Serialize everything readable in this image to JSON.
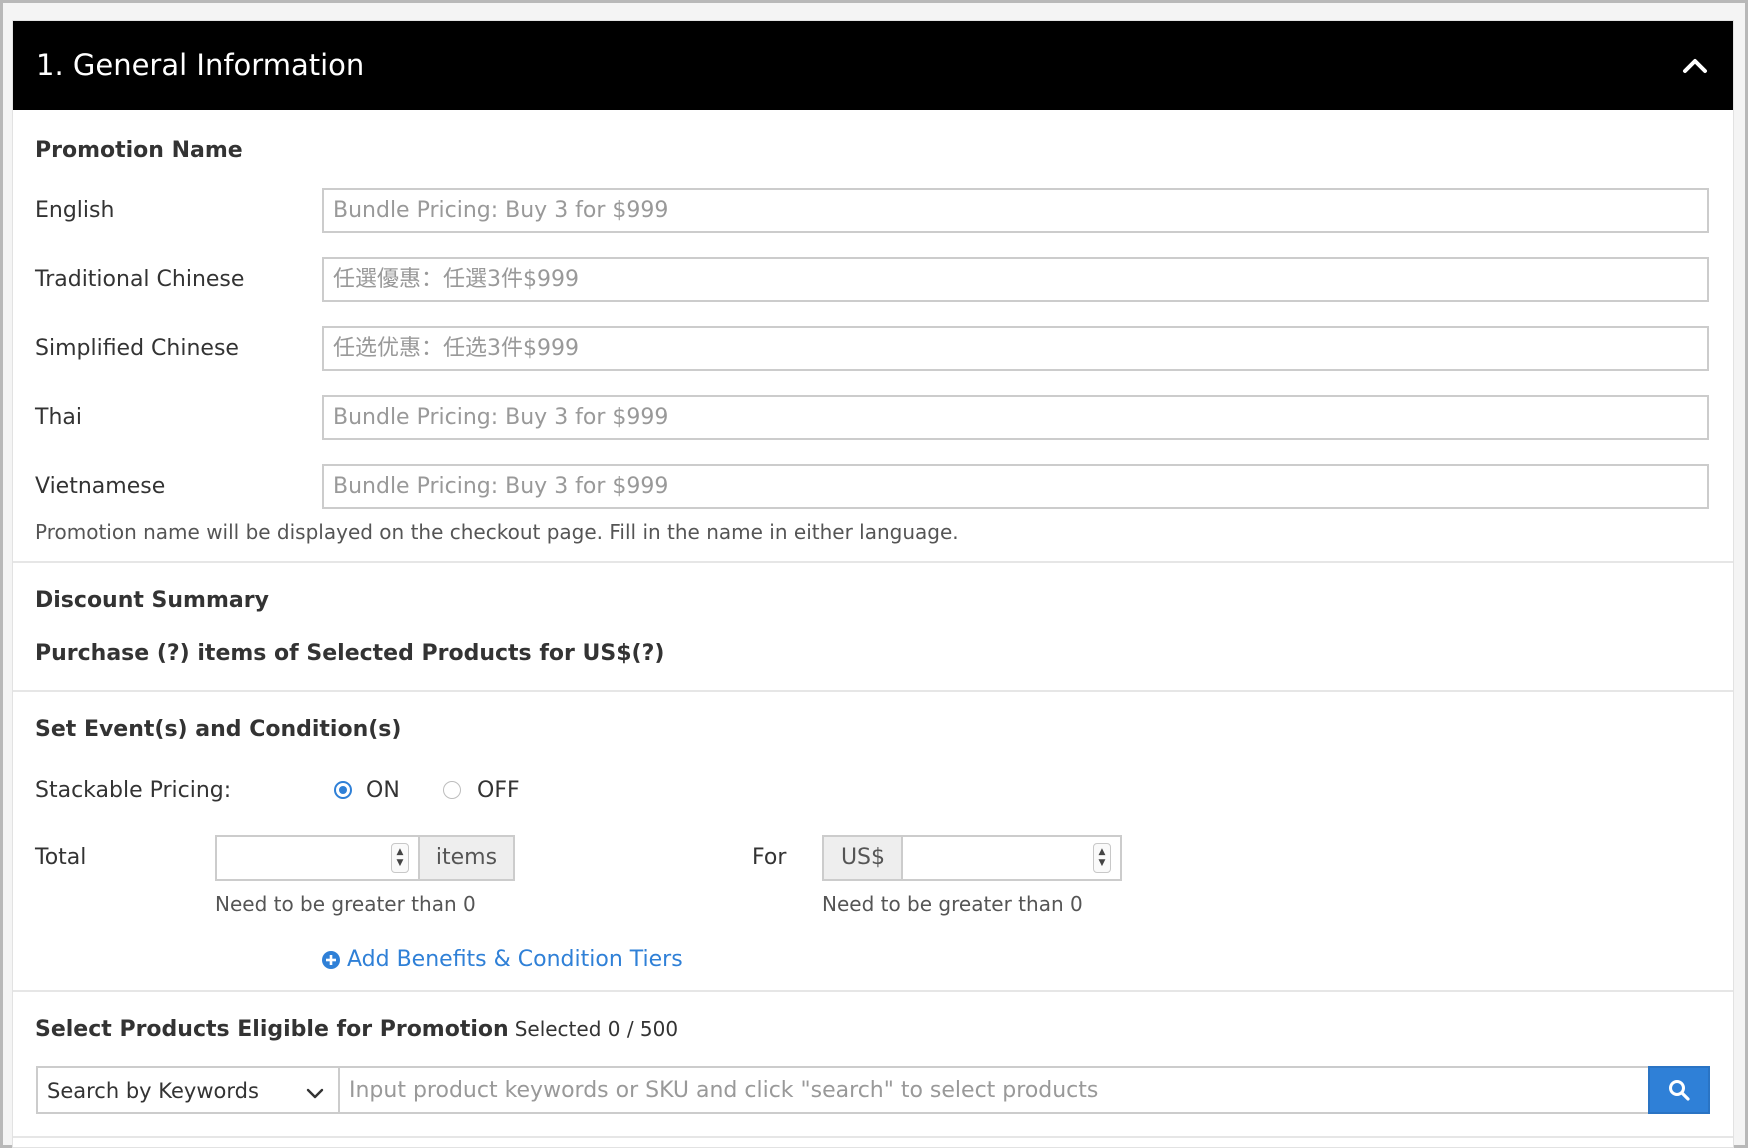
{
  "section": {
    "title": "1. General Information"
  },
  "promotion_name": {
    "title": "Promotion Name",
    "fields": [
      {
        "label": "English",
        "placeholder": "Bundle Pricing: Buy 3 for $999",
        "value": ""
      },
      {
        "label": "Traditional Chinese",
        "placeholder": "任選優惠：任選3件$999",
        "value": ""
      },
      {
        "label": "Simplified Chinese",
        "placeholder": "任选优惠：任选3件$999",
        "value": ""
      },
      {
        "label": "Thai",
        "placeholder": "Bundle Pricing: Buy 3 for $999",
        "value": ""
      },
      {
        "label": "Vietnamese",
        "placeholder": "Bundle Pricing: Buy 3 for $999",
        "value": ""
      }
    ],
    "help": "Promotion name will be displayed on the checkout page. Fill in the name in either language."
  },
  "discount_summary": {
    "title": "Discount Summary",
    "text": "Purchase (?) items of Selected Products for US$(?)"
  },
  "events": {
    "title": "Set Event(s) and Condition(s)",
    "stackable_label": "Stackable Pricing:",
    "on_label": "ON",
    "off_label": "OFF",
    "selected": "ON",
    "total_label": "Total",
    "total_value": "",
    "items_addon": "items",
    "total_help": "Need to be greater than 0",
    "for_label": "For",
    "currency_addon": "US$",
    "price_value": "",
    "price_help": "Need to be greater than 0",
    "add_tiers_label": "Add Benefits & Condition Tiers"
  },
  "products": {
    "title": "Select Products Eligible for Promotion",
    "selected_text": "Selected 0 / 500",
    "search_mode": "Search by Keywords",
    "search_placeholder": "Input product keywords or SKU and click \"search\" to select products",
    "search_value": ""
  },
  "colors": {
    "header_bg": "#000000",
    "accent": "#2f80d7",
    "border": "#cccccc"
  },
  "icons": {
    "collapse": "chevron-up-icon",
    "add": "plus-circle-icon",
    "dropdown": "chevron-down-icon",
    "search": "search-icon"
  }
}
